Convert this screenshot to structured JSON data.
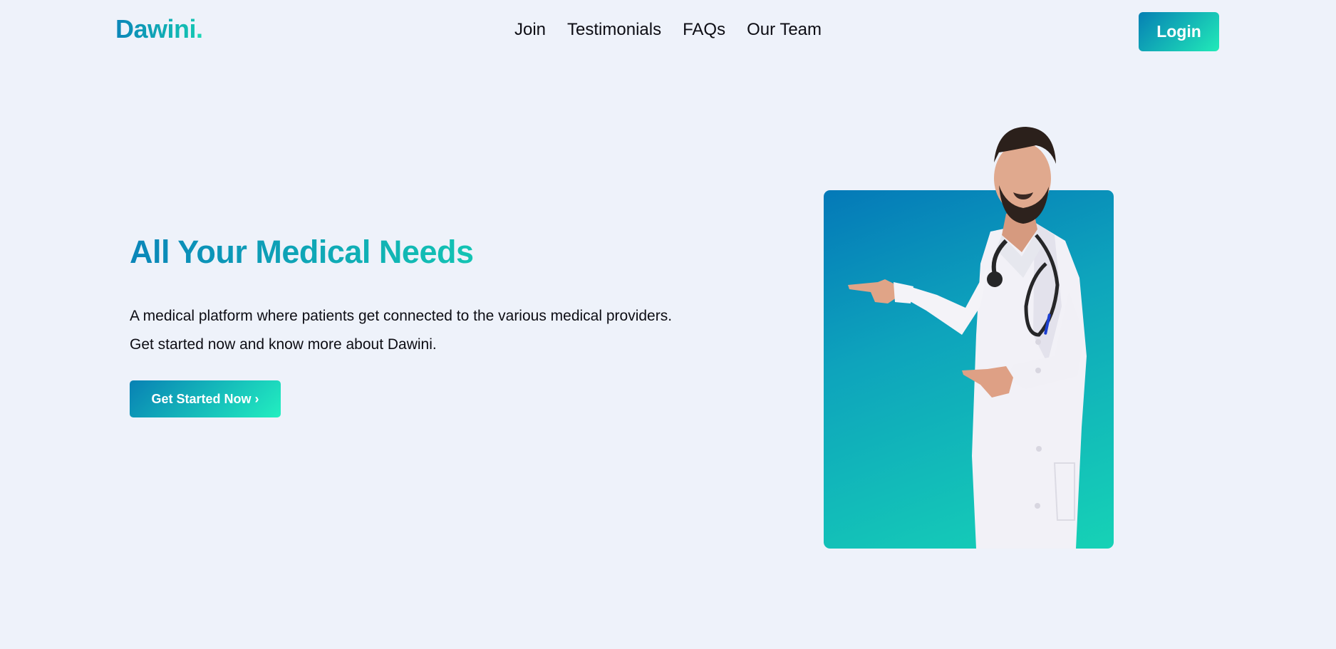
{
  "brand": {
    "name": "Dawini",
    "dot": "."
  },
  "nav": {
    "links": [
      "Join",
      "Testimonials",
      "FAQs",
      "Our Team"
    ],
    "login_label": "Login"
  },
  "hero": {
    "title": "All Your Medical Needs",
    "description_line1": "A medical platform where patients get connected to the various medical providers.",
    "description_line2": "Get started now and know more about Dawini.",
    "cta_label": "Get Started Now ›"
  },
  "colors": {
    "background": "#eef2fa",
    "accent_start": "#0680b4",
    "accent_end": "#21eab8",
    "text": "#0d0d14"
  },
  "image": {
    "subject": "doctor-pointing-illustration"
  }
}
